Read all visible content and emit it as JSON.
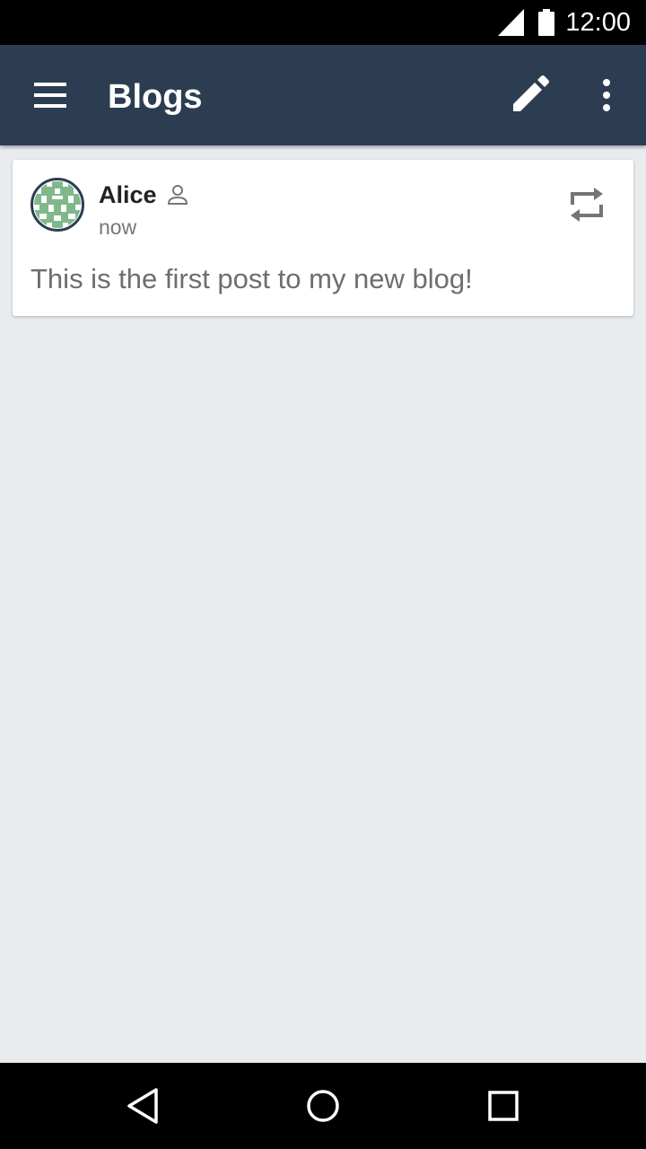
{
  "status_bar": {
    "time": "12:00",
    "icons": [
      "signal-icon",
      "battery-icon"
    ]
  },
  "app_bar": {
    "title": "Blogs",
    "icons": [
      "menu-icon",
      "edit-icon",
      "more-vert-icon"
    ]
  },
  "post": {
    "author": "Alice",
    "author_icon": "person-outline-icon",
    "time": "now",
    "text": "This is the first post to my new blog!",
    "action_icon": "repost-icon"
  },
  "nav_bar": {
    "icons": [
      "back-icon",
      "home-icon",
      "recents-icon"
    ]
  },
  "colors": {
    "app_bar": "#2c3d51",
    "background": "#e8ecef",
    "card": "#ffffff",
    "avatar_accent": "#80b88c",
    "avatar_ring": "#2c3d51"
  }
}
